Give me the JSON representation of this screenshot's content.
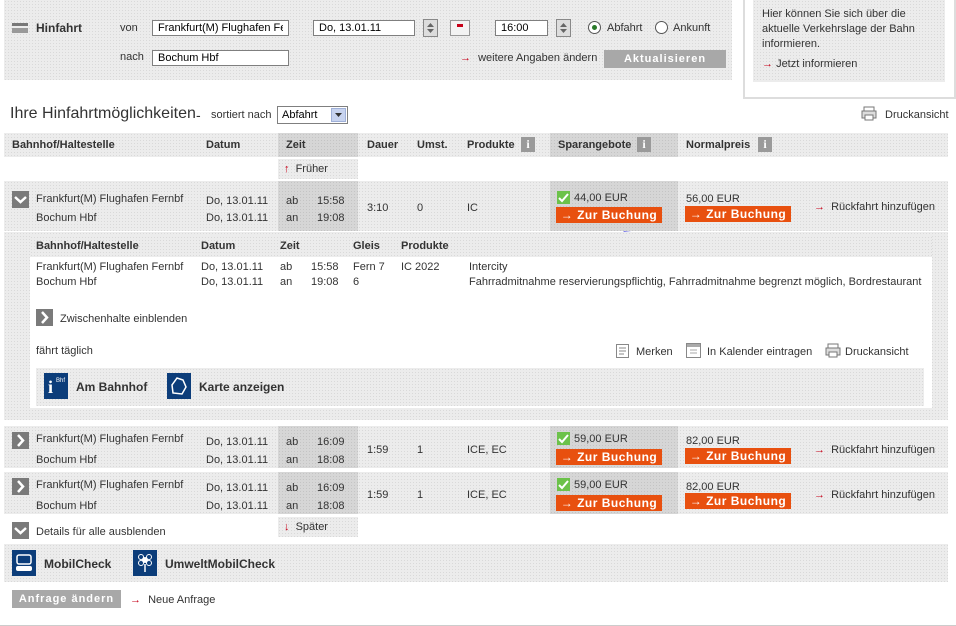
{
  "search": {
    "section_label": "Hinfahrt",
    "from_label": "von",
    "from_value": "Frankfurt(M) Flughafen Fe",
    "to_label": "nach",
    "to_value": "Bochum Hbf",
    "date_value": "Do, 13.01.11",
    "time_value": "16:00",
    "departure_label": "Abfahrt",
    "arrival_label": "Ankunft",
    "more_label": "weitere Angaben ändern",
    "update_label": "Aktualisieren"
  },
  "infobox": {
    "text": "Hier können Sie sich über die aktuelle Verkehrslage der Bahn informieren.",
    "link": "Jetzt informieren"
  },
  "results": {
    "title": "Ihre Hinfahrtmöglichkeiten",
    "dash": "-",
    "sort_label": "sortiert nach",
    "sort_value": "Abfahrt",
    "print_label": "Druckansicht",
    "headers": {
      "station": "Bahnhof/Haltestelle",
      "date": "Datum",
      "time": "Zeit",
      "duration": "Dauer",
      "changes": "Umst.",
      "products": "Produkte",
      "savings": "Sparangebote",
      "normal": "Normalpreis"
    },
    "earlier": "Früher",
    "later": "Später",
    "book_label": "Zur Buchung",
    "return_label": "Rückfahrt hinzufügen",
    "dep_abbr": "ab",
    "arr_abbr": "an",
    "connections": [
      {
        "from": "Frankfurt(M) Flughafen Fernbf",
        "to": "Bochum Hbf",
        "date1": "Do, 13.01.11",
        "date2": "Do, 13.01.11",
        "dep": "15:58",
        "arr": "19:08",
        "duration": "3:10",
        "changes": "0",
        "products": "IC",
        "saver": "44,00 EUR",
        "normal": "56,00 EUR"
      },
      {
        "from": "Frankfurt(M) Flughafen Fernbf",
        "to": "Bochum Hbf",
        "date1": "Do, 13.01.11",
        "date2": "Do, 13.01.11",
        "dep": "16:09",
        "arr": "18:08",
        "duration": "1:59",
        "changes": "1",
        "products": "ICE, EC",
        "saver": "59,00 EUR",
        "normal": "82,00 EUR"
      },
      {
        "from": "Frankfurt(M) Flughafen Fernbf",
        "to": "Bochum Hbf",
        "date1": "Do, 13.01.11",
        "date2": "Do, 13.01.11",
        "dep": "16:09",
        "arr": "18:08",
        "duration": "1:59",
        "changes": "1",
        "products": "ICE, EC",
        "saver": "59,00 EUR",
        "normal": "82,00 EUR"
      }
    ],
    "hide_all": "Details für alle ausblenden"
  },
  "details": {
    "headers": {
      "station": "Bahnhof/Haltestelle",
      "date": "Datum",
      "time": "Zeit",
      "track": "Gleis",
      "products": "Produkte"
    },
    "row1": {
      "station": "Frankfurt(M) Flughafen Fernbf",
      "date": "Do, 13.01.11",
      "abbr": "ab",
      "time": "15:58",
      "track": "Fern 7",
      "product": "IC 2022",
      "info": "Intercity"
    },
    "row2": {
      "station": "Bochum Hbf",
      "date": "Do, 13.01.11",
      "abbr": "an",
      "time": "19:08",
      "track": "6",
      "info": "Fahrradmitnahme reservierungspflichtig, Fahrradmitnahme begrenzt möglich, Bordrestaurant"
    },
    "stops_label": "Zwischenhalte einblenden",
    "daily": "fährt täglich",
    "remember": "Merken",
    "calendar": "In Kalender eintragen",
    "print": "Druckansicht",
    "station_btn": "Am Bahnhof",
    "map_btn": "Karte anzeigen"
  },
  "footer": {
    "mobilcheck": "MobilCheck",
    "umwelt": "UmweltMobilCheck",
    "change_request": "Anfrage ändern",
    "new_request": "Neue Anfrage"
  },
  "colors": {
    "accent": "#e8500f",
    "red": "#c60018",
    "check": "#6cc24a"
  }
}
